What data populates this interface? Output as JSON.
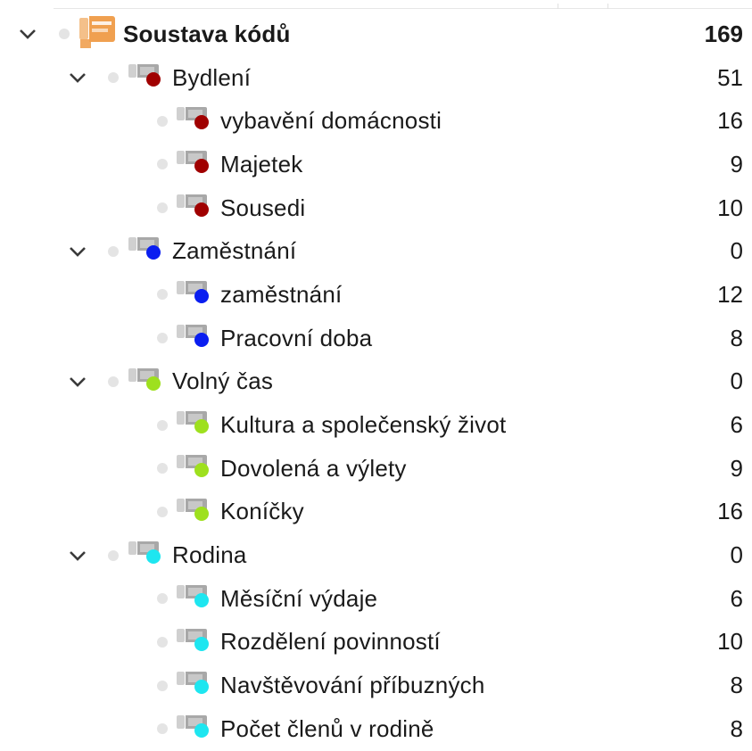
{
  "tree": {
    "root": {
      "label": "Soustava kódů",
      "count": "169",
      "icon": "code-system-icon",
      "color": "#f0a050"
    },
    "groups": [
      {
        "label": "Bydlení",
        "count": "51",
        "color": "#a00000",
        "children": [
          {
            "label": "vybavění domácnosti",
            "count": "16"
          },
          {
            "label": "Majetek",
            "count": "9"
          },
          {
            "label": "Sousedi",
            "count": "10"
          }
        ]
      },
      {
        "label": "Zaměstnání",
        "count": "0",
        "color": "#0a1ef0",
        "children": [
          {
            "label": "zaměstnání",
            "count": "12"
          },
          {
            "label": "Pracovní doba",
            "count": "8"
          }
        ]
      },
      {
        "label": "Volný čas",
        "count": "0",
        "color": "#9ee01e",
        "children": [
          {
            "label": "Kultura a společenský život",
            "count": "6"
          },
          {
            "label": "Dovolená a výlety",
            "count": "9"
          },
          {
            "label": "Koníčky",
            "count": "16"
          }
        ]
      },
      {
        "label": "Rodina",
        "count": "0",
        "color": "#1ee6f0",
        "children": [
          {
            "label": "Měsíční výdaje",
            "count": "6"
          },
          {
            "label": "Rozdělení povinností",
            "count": "10"
          },
          {
            "label": "Navštěvování příbuzných",
            "count": "8"
          },
          {
            "label": "Počet členů v rodině",
            "count": "8"
          }
        ]
      }
    ]
  }
}
